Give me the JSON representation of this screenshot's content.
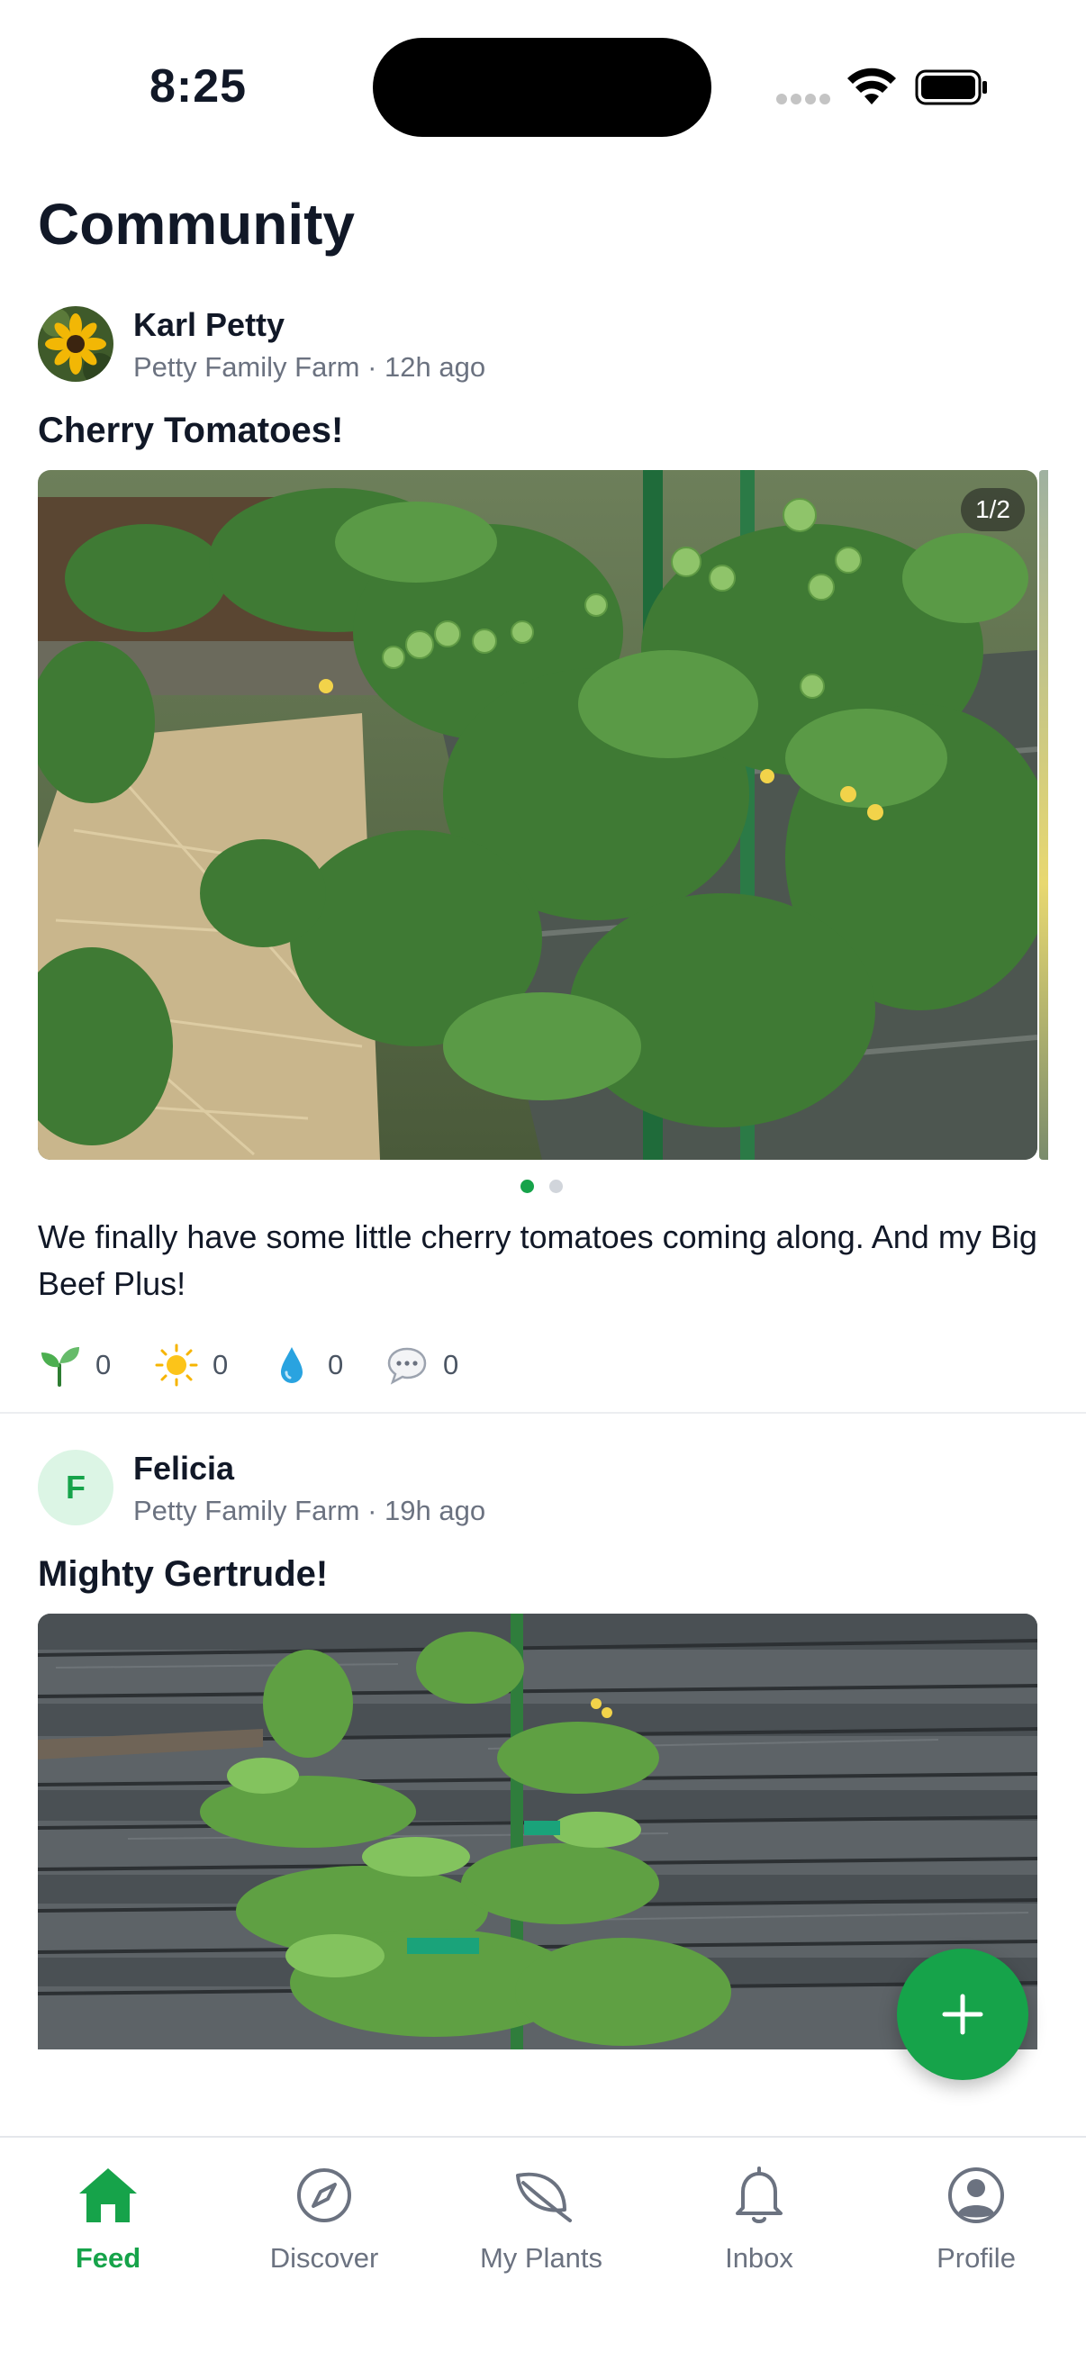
{
  "status_bar": {
    "time": "8:25"
  },
  "header": {
    "title": "Community"
  },
  "posts": [
    {
      "author": "Karl Petty",
      "farm": "Petty Family Farm",
      "time_ago": "12h ago",
      "meta": "Petty Family Farm · 12h ago",
      "title": "Cherry Tomatoes!",
      "image_counter": "1/2",
      "body": "We finally have some little cherry tomatoes coming along.  And my Big Beef Plus!",
      "reactions": {
        "sprout": "0",
        "sun": "0",
        "water": "0",
        "comments": "0"
      }
    },
    {
      "author": "Felicia",
      "avatar_initial": "F",
      "farm": "Petty Family Farm",
      "time_ago": "19h ago",
      "meta": "Petty Family Farm · 19h ago",
      "title": "Mighty Gertrude!"
    }
  ],
  "tabs": [
    {
      "label": "Feed",
      "icon": "home-icon",
      "active": true
    },
    {
      "label": "Discover",
      "icon": "compass-icon",
      "active": false
    },
    {
      "label": "My Plants",
      "icon": "leaf-icon",
      "active": false
    },
    {
      "label": "Inbox",
      "icon": "bell-icon",
      "active": false
    },
    {
      "label": "Profile",
      "icon": "user-circle-icon",
      "active": false
    }
  ],
  "colors": {
    "accent": "#16a34a",
    "text": "#111827",
    "muted": "#6b7280"
  }
}
